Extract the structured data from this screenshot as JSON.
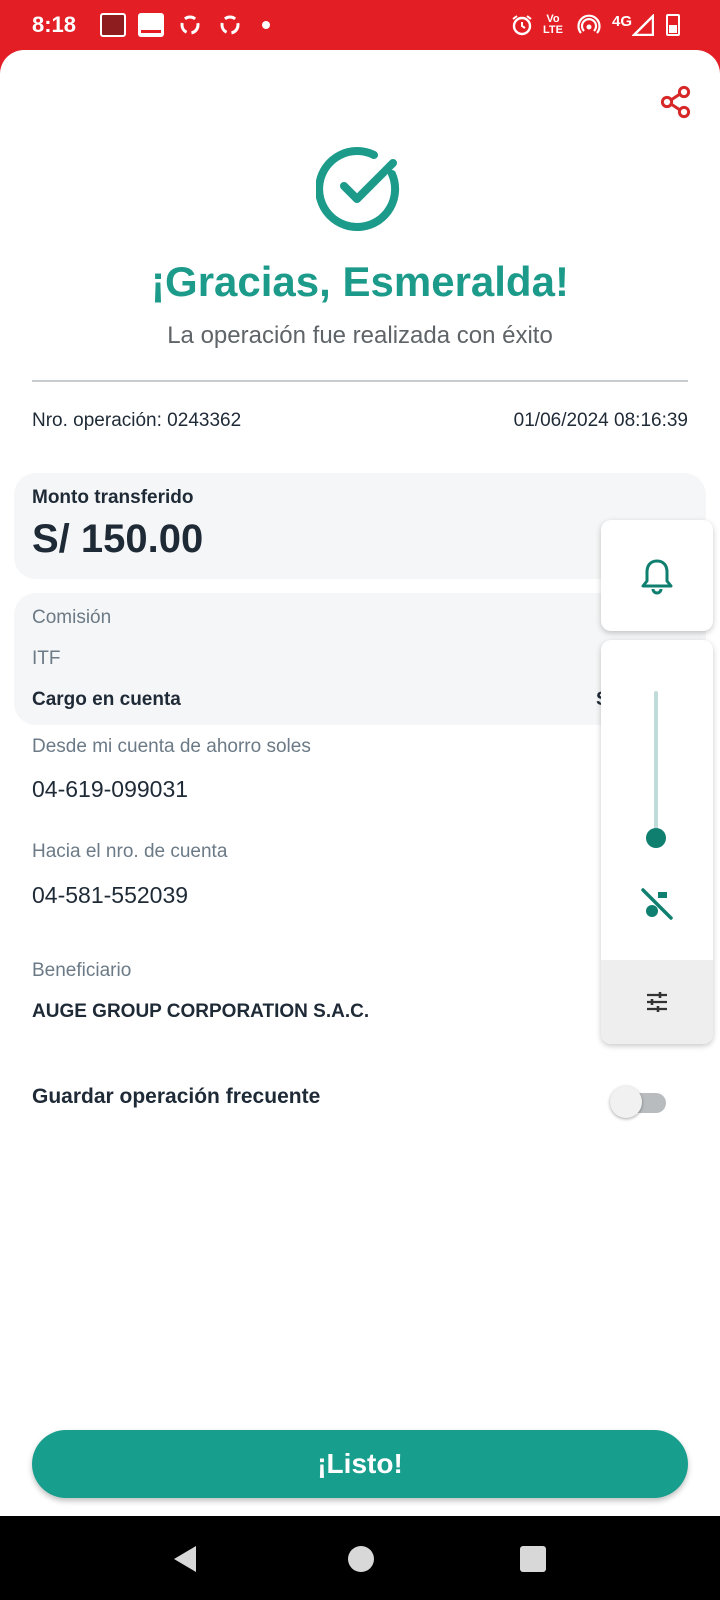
{
  "status_bar": {
    "time": "8:18",
    "network": "4G",
    "volte_top": "Vo",
    "volte_bottom": "LTE",
    "icons": [
      "notification-app-icon",
      "notification-app-icon",
      "sync-icon",
      "sync-icon",
      "dot-icon",
      "alarm-icon",
      "volte-icon",
      "hotspot-icon",
      "signal-icon",
      "battery-icon"
    ]
  },
  "header": {
    "share_icon": "share-icon",
    "success_icon": "check-circle-icon",
    "title": "¡Gracias, Esmeralda!",
    "subtitle": "La operación fue realizada con éxito"
  },
  "operation": {
    "number_label": "Nro. operación: 0243362",
    "datetime": "01/06/2024 08:16:39"
  },
  "amount": {
    "label": "Monto transferido",
    "value": "S/ 150.00"
  },
  "fees": {
    "commission_label": "Comisión",
    "itf_label": "ITF",
    "charge_label": "Cargo en cuenta",
    "charge_value": "S"
  },
  "details": {
    "from_label": "Desde mi cuenta de ahorro soles",
    "from_value": "04-619-099031",
    "to_label": "Hacia el nro. de cuenta",
    "to_value": "04-581-552039",
    "beneficiary_label": "Beneficiario",
    "beneficiary_value": "AUGE GROUP CORPORATION S.A.C."
  },
  "save_frequent": {
    "label": "Guardar operación frecuente",
    "enabled": false
  },
  "primary_button": {
    "label": "¡Listo!"
  },
  "volume_overlay": {
    "ring_mode_icon": "bell-icon",
    "mute_icon": "music-off-icon",
    "settings_icon": "sliders-icon",
    "level": 0.0
  },
  "colors": {
    "status_bar": "#e31e24",
    "accent": "#1c9a8a",
    "button": "#179e8d",
    "share": "#d62828"
  }
}
